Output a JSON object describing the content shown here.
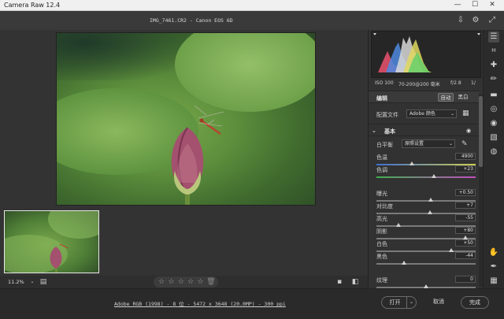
{
  "window": {
    "title": "Camera Raw 12.4",
    "minimize": "—",
    "maximize": "☐",
    "close": "✕"
  },
  "header": {
    "file_title": "IMG_7461.CR2  -  Canon EOS 6D"
  },
  "canvas": {
    "zoom": "11.2%",
    "rating_stars": 0
  },
  "histogram": {
    "meta": {
      "iso": "ISO 100",
      "lens": "70-200@200 毫米",
      "aperture": "f/2.8",
      "shutter": "1/"
    }
  },
  "edit": {
    "title": "编辑",
    "auto_label": "自动",
    "bw_label": "黑白",
    "profile_label": "配置文件",
    "profile_value": "Adobe 颜色",
    "basic_title": "基本",
    "wb_label": "白平衡",
    "wb_value": "原照设置",
    "sliders": [
      {
        "label": "色温",
        "value": "4900",
        "fraction": 0.36
      },
      {
        "label": "色调",
        "value": "+23",
        "fraction": 0.58
      },
      {
        "label": "曝光",
        "value": "+0.50",
        "fraction": 0.55
      },
      {
        "label": "对比度",
        "value": "+7",
        "fraction": 0.54
      },
      {
        "label": "高光",
        "value": "-55",
        "fraction": 0.22
      },
      {
        "label": "阴影",
        "value": "+80",
        "fraction": 0.9
      },
      {
        "label": "白色",
        "value": "+50",
        "fraction": 0.75
      },
      {
        "label": "黑色",
        "value": "-44",
        "fraction": 0.28
      },
      {
        "label": "纹理",
        "value": "0",
        "fraction": 0.5
      }
    ]
  },
  "footer": {
    "workflow_link": "Adobe RGB (1998) - 8 位 - 5472 x 3648 (20.0MP) - 300 ppi",
    "open_label": "打开",
    "cancel_label": "取消",
    "done_label": "完成"
  },
  "colors": {
    "panel": "#323232",
    "background": "#2b2b2b",
    "accent_text": "#e0e0e0"
  }
}
